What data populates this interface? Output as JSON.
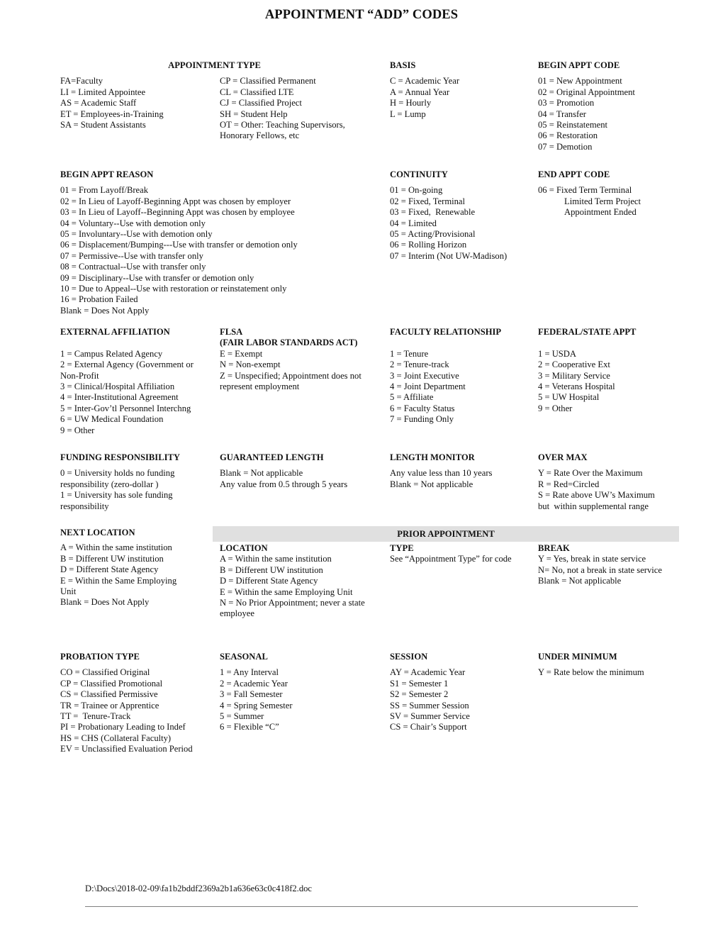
{
  "document": {
    "title": "APPOINTMENT “ADD” CODES",
    "footer_path": "D:\\Docs\\2018-02-09\\fa1b2bddf2369a2b1a636e63c0c418f2.doc"
  },
  "appointment_type": {
    "heading": "APPOINTMENT TYPE",
    "col1": [
      "FA=Faculty",
      "LI = Limited Appointee",
      "AS = Academic Staff",
      "ET = Employees-in-Training",
      "SA = Student Assistants"
    ],
    "col2": [
      "CP = Classified Permanent",
      "CL = Classified LTE",
      "CJ = Classified Project",
      "SH = Student Help",
      "OT = Other: Teaching Supervisors,",
      "Honorary Fellows, etc"
    ]
  },
  "basis": {
    "heading": "BASIS",
    "items": [
      "C = Academic Year",
      "A = Annual Year",
      "H = Hourly",
      "L = Lump"
    ]
  },
  "begin_appt_code": {
    "heading": "BEGIN APPT CODE",
    "items": [
      "01 = New Appointment",
      "02 = Original Appointment",
      "03 = Promotion",
      "04 = Transfer",
      "05 = Reinstatement",
      "06 = Restoration",
      "07 = Demotion"
    ]
  },
  "begin_appt_reason": {
    "heading": "BEGIN APPT REASON",
    "items": [
      "01 = From Layoff/Break",
      "02 = In Lieu of Layoff-Beginning Appt was chosen by employer",
      "03 = In Lieu of Layoff--Beginning Appt was chosen by employee",
      "04 = Voluntary--Use with demotion only",
      "05 = Involuntary--Use with demotion only",
      "06 = Displacement/Bumping---Use with transfer or demotion only",
      "07 = Permissive--Use with transfer only",
      "08 = Contractual--Use with transfer only",
      "09 = Disciplinary--Use with transfer or demotion only",
      "10 = Due to Appeal--Use with restoration or reinstatement only",
      "16 = Probation Failed",
      "Blank = Does Not Apply"
    ]
  },
  "continuity": {
    "heading": "CONTINUITY",
    "items": [
      "01 = On-going",
      "02 = Fixed, Terminal",
      "03 = Fixed,  Renewable",
      "04 = Limited",
      "05 = Acting/Provisional",
      "06 = Rolling Horizon",
      "07 = Interim (Not UW-Madison)"
    ]
  },
  "end_appt_code": {
    "heading": "END APPT CODE",
    "first": "06 = Fixed Term Terminal",
    "continuation": [
      "Limited Term Project",
      "Appointment Ended"
    ]
  },
  "external_affiliation": {
    "heading": "EXTERNAL AFFILIATION",
    "items": [
      "1 = Campus Related Agency",
      "2 = External Agency (Government or",
      "Non-Profit",
      "3 = Clinical/Hospital Affiliation",
      "4 = Inter-Institutional Agreement",
      "5 = Inter-Gov’tl Personnel Interchng",
      "6 = UW Medical Foundation",
      "9 = Other"
    ]
  },
  "flsa": {
    "heading": "FLSA",
    "subheading": "(FAIR LABOR STANDARDS ACT)",
    "items": [
      "E = Exempt",
      "N = Non-exempt",
      "Z = Unspecified; Appointment does not",
      "represent employment"
    ]
  },
  "faculty_relationship": {
    "heading": "FACULTY RELATIONSHIP",
    "items": [
      "1 = Tenure",
      "2 = Tenure-track",
      "3 = Joint Executive",
      "4 = Joint Department",
      "5 = Affiliate",
      "6 = Faculty Status",
      "7 = Funding Only"
    ]
  },
  "federal_state_appt": {
    "heading": "FEDERAL/STATE APPT",
    "items": [
      "1 = USDA",
      "2 = Cooperative Ext",
      "3 = Military Service",
      "4 = Veterans Hospital",
      "5 = UW Hospital",
      "9 = Other"
    ]
  },
  "funding_responsibility": {
    "heading": "FUNDING RESPONSIBILITY",
    "items": [
      "0 = University holds no funding",
      "responsibility (zero-dollar )",
      "1 = University has sole funding",
      "responsibility"
    ]
  },
  "guaranteed_length": {
    "heading": "GUARANTEED LENGTH",
    "items": [
      "Blank = Not applicable",
      "Any value from 0.5 through 5 years"
    ]
  },
  "length_monitor": {
    "heading": "LENGTH MONITOR",
    "items": [
      "Any value less than 10 years",
      "Blank = Not applicable"
    ]
  },
  "over_max": {
    "heading": "OVER MAX",
    "items": [
      "Y = Rate Over the Maximum",
      "R = Red=Circled",
      "S = Rate above UW’s Maximum",
      "but  within supplemental range"
    ]
  },
  "next_location": {
    "heading": "NEXT LOCATION",
    "items": [
      "A = Within the same institution",
      "B = Different UW institution",
      "D = Different State Agency",
      "E = Within the Same Employing",
      "Unit",
      "Blank = Does Not Apply"
    ]
  },
  "prior_appointment": {
    "heading": "PRIOR APPOINTMENT",
    "location": {
      "heading": "LOCATION",
      "items": [
        "A = Within the same institution",
        "B = Different UW institution",
        "D = Different State Agency",
        "E = Within the same Employing Unit",
        "N = No Prior Appointment; never a state",
        "employee"
      ]
    },
    "type": {
      "heading": "TYPE",
      "items": [
        "See “Appointment Type” for code"
      ]
    },
    "break": {
      "heading": "BREAK",
      "items": [
        "Y = Yes, break in state service",
        "N= No, not a break in state service",
        "Blank = Not applicable"
      ]
    }
  },
  "probation_type": {
    "heading": "PROBATION TYPE",
    "items": [
      "CO = Classified Original",
      "CP = Classified Promotional",
      "CS = Classified Permissive",
      "TR = Trainee or Apprentice",
      "TT =  Tenure-Track",
      "PI = Probationary Leading to Indef",
      "HS = CHS (Collateral Faculty)",
      "EV = Unclassified Evaluation Period"
    ]
  },
  "seasonal": {
    "heading": "SEASONAL",
    "items": [
      "1 = Any Interval",
      "2 = Academic Year",
      "3 = Fall Semester",
      "4 = Spring Semester",
      "5 = Summer",
      "6 = Flexible “C”"
    ]
  },
  "session": {
    "heading": "SESSION",
    "items": [
      "AY = Academic Year",
      "S1 = Semester 1",
      "S2 = Semester 2",
      "SS = Summer Session",
      "SV = Summer Service",
      "CS = Chair’s Support"
    ]
  },
  "under_minimum": {
    "heading": "UNDER MINIMUM",
    "items": [
      "Y = Rate below the minimum"
    ]
  }
}
